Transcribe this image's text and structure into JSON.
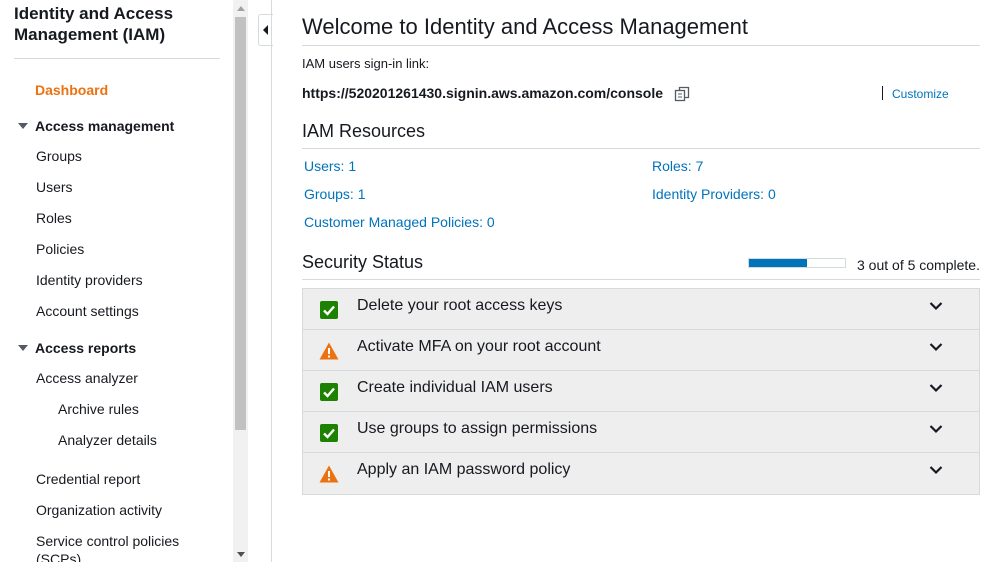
{
  "sidebar": {
    "title": "Identity and Access Management (IAM)",
    "dashboard": "Dashboard",
    "access_management": {
      "label": "Access management",
      "items": [
        "Groups",
        "Users",
        "Roles",
        "Policies",
        "Identity providers",
        "Account settings"
      ]
    },
    "access_reports": {
      "label": "Access reports",
      "analyzer": "Access analyzer",
      "analyzer_children": [
        "Archive rules",
        "Analyzer details"
      ],
      "items": [
        "Credential report",
        "Organization activity",
        "Service control policies (SCPs)"
      ]
    }
  },
  "main": {
    "title": "Welcome to Identity and Access Management",
    "signin_label": "IAM users sign-in link:",
    "signin_url": "https://520201261430.signin.aws.amazon.com/console",
    "customize": "Customize",
    "resources_title": "IAM Resources",
    "resources": {
      "users": "Users: 1",
      "roles": "Roles: 7",
      "groups": "Groups: 1",
      "identity_providers": "Identity Providers: 0",
      "customer_managed_policies": "Customer Managed Policies: 0"
    },
    "security_title": "Security Status",
    "progress": {
      "completed": 3,
      "total": 5,
      "text": "3 out of 5 complete."
    },
    "security_items": [
      {
        "label": "Delete your root access keys",
        "status": "complete"
      },
      {
        "label": "Activate MFA on your root account",
        "status": "warning"
      },
      {
        "label": "Create individual IAM users",
        "status": "complete"
      },
      {
        "label": "Use groups to assign permissions",
        "status": "complete"
      },
      {
        "label": "Apply an IAM password policy",
        "status": "warning"
      }
    ]
  },
  "colors": {
    "accent_orange": "#ec7211",
    "link_blue": "#0073bb",
    "success_green": "#1d8102",
    "warning_orange": "#ec7211"
  }
}
